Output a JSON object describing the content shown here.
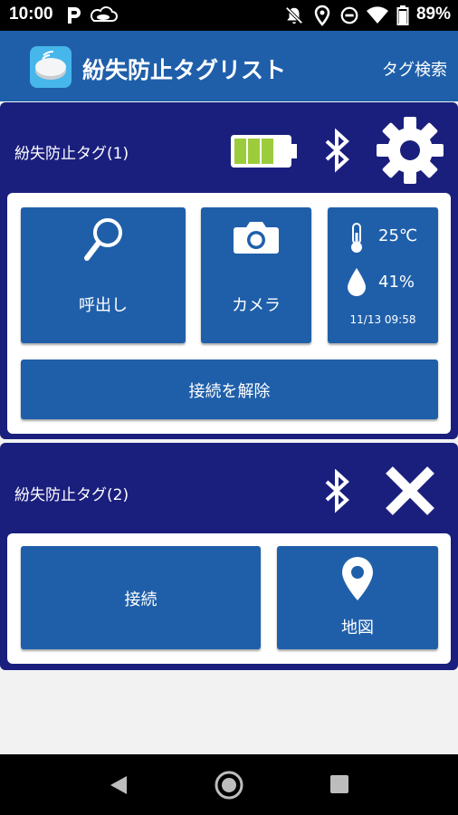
{
  "status_bar": {
    "time": "10:00",
    "battery_percent": "89%",
    "icons": [
      "p-icon",
      "cloud-icon",
      "notifications-off-icon",
      "location-icon",
      "do-not-disturb-icon",
      "wifi-icon",
      "battery-icon"
    ]
  },
  "app_bar": {
    "title": "紛失防止タグリスト",
    "search_label": "タグ検索",
    "logo_icon": "tag-device-icon"
  },
  "tags": [
    {
      "name": "紛失防止タグ(1)",
      "battery_level_bars": 3,
      "battery_level_max": 4,
      "call_label": "呼出し",
      "camera_label": "カメラ",
      "temperature": "25℃",
      "humidity": "41%",
      "sensor_time": "11/13 09:58",
      "disconnect_label": "接続を解除"
    },
    {
      "name": "紛失防止タグ(2)",
      "connect_label": "接続",
      "map_label": "地図"
    }
  ],
  "colors": {
    "app_bar": "#1f5faa",
    "card_background": "#1a1f7e",
    "tile": "#1f5faa",
    "battery_fill": "#9ccc3c",
    "logo_background": "#47b6ea"
  }
}
